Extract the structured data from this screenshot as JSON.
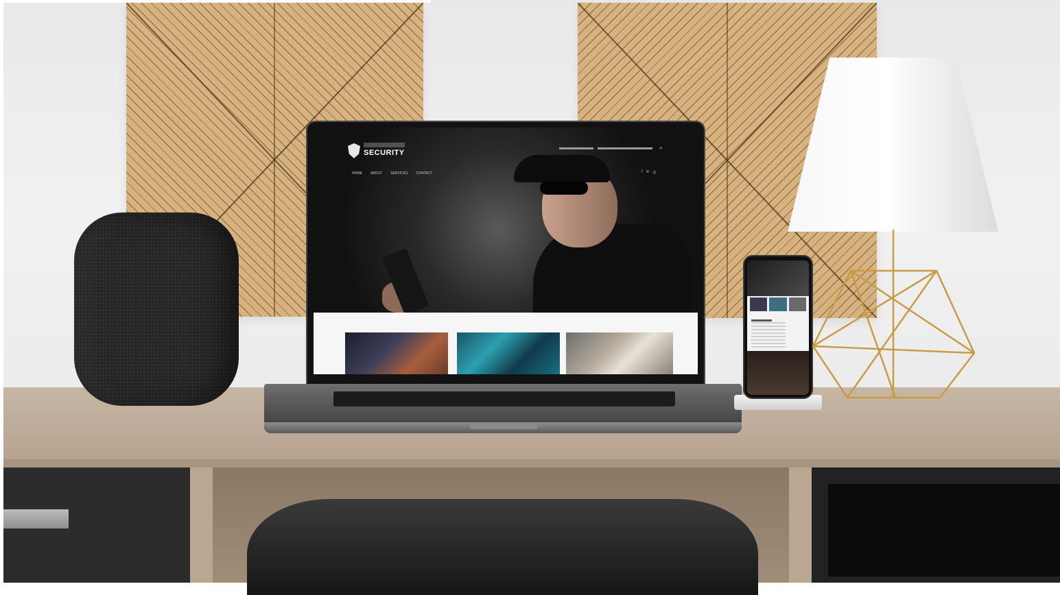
{
  "scene": {
    "description_elements": [
      "wall",
      "wood-panels",
      "smart-speaker",
      "laptop",
      "smartphone",
      "table-lamp",
      "desk",
      "chair"
    ]
  },
  "laptop_site": {
    "brand_line_2": "SECURITY",
    "nav": [
      "HOME",
      "ABOUT",
      "SERVICES",
      "CONTACT"
    ]
  },
  "colors": {
    "wood": "#d8b27e",
    "wall": "#ececec",
    "desk": "#bcaa95",
    "dark": "#121212",
    "lamp_gold": "#c89b45"
  }
}
